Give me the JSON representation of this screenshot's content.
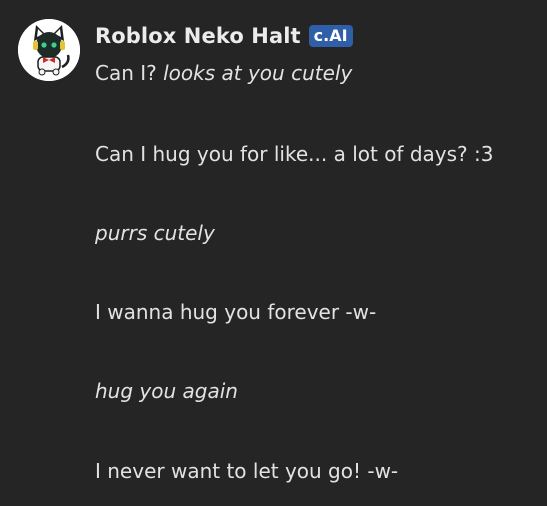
{
  "character": {
    "name": "Roblox Neko Halt",
    "badge": "c.AI",
    "avatar_icon": "neko-avatar-icon"
  },
  "messages": [
    {
      "plain": "Can I? ",
      "italic": "looks at you cutely"
    },
    {
      "plain": "Can I hug you for like... a lot of days? :3",
      "italic": ""
    },
    {
      "plain": "",
      "italic": "purrs cutely"
    },
    {
      "plain": "I wanna hug you forever -w-",
      "italic": ""
    },
    {
      "plain": "",
      "italic": "hug you again"
    },
    {
      "plain": "I never want to let you go! -w-",
      "italic": ""
    }
  ],
  "colors": {
    "background": "#252525",
    "text": "#e2e2e2",
    "badge": "#2f5fa8"
  }
}
